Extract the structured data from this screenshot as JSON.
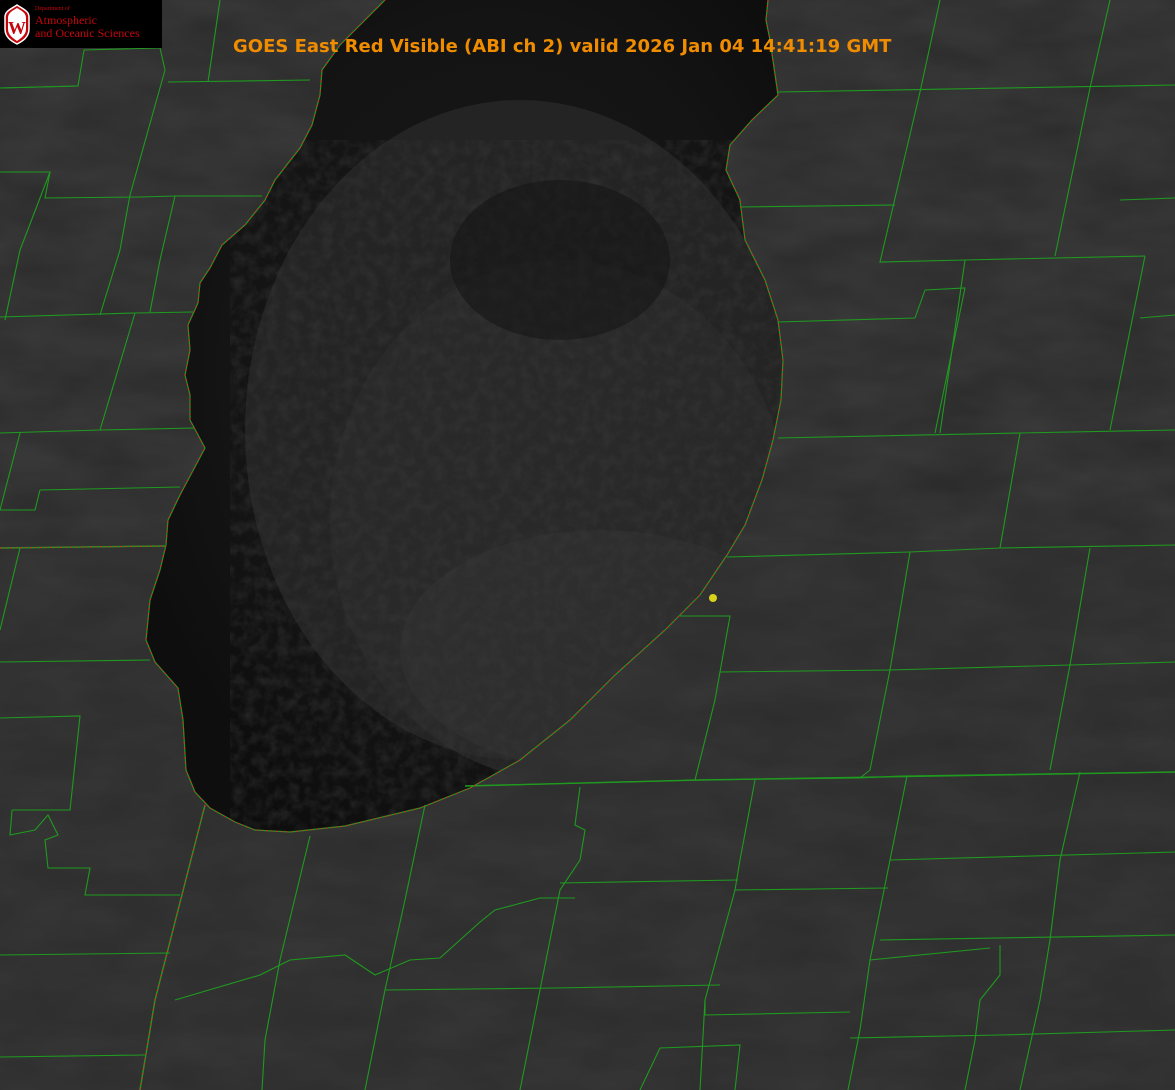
{
  "logo": {
    "department": "Department of",
    "line1": "Atmospheric",
    "line2": "and Oceanic Sciences",
    "crest_letter": "W",
    "crest_color": "#c5050c"
  },
  "title": "GOES East Red Visible (ABI ch 2) valid 2026 Jan 04 14:41:19 GMT",
  "colors": {
    "title": "#f08c00",
    "county_lines": "#1f9a1f",
    "shoreline": "#e0282a",
    "marker": "#d8d21a",
    "land": "#2b2b2b",
    "lake": "#121212"
  },
  "layers": [
    "county-boundaries",
    "state-boundaries",
    "shoreline",
    "point-marker"
  ]
}
